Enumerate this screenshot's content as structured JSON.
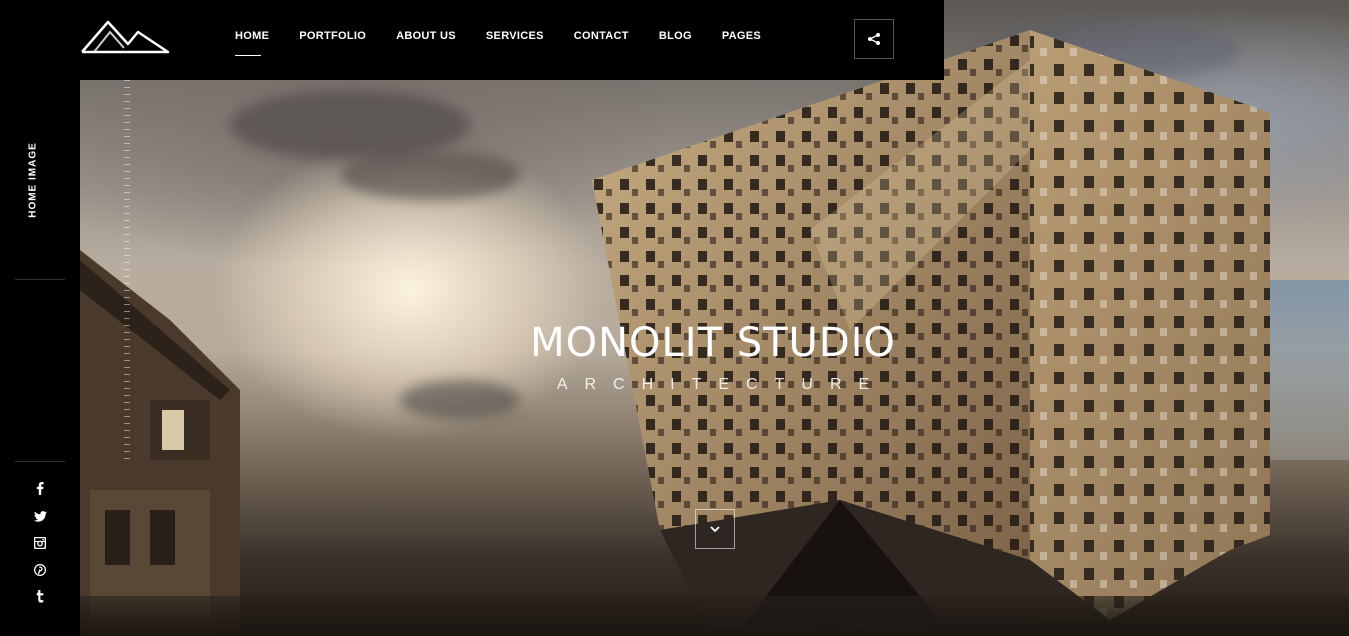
{
  "nav": {
    "items": [
      {
        "label": "HOME",
        "active": true
      },
      {
        "label": "PORTFOLIO",
        "active": false
      },
      {
        "label": "ABOUT US",
        "active": false
      },
      {
        "label": "SERVICES",
        "active": false
      },
      {
        "label": "CONTACT",
        "active": false
      },
      {
        "label": "BLOG",
        "active": false
      },
      {
        "label": "PAGES",
        "active": false
      }
    ],
    "share_icon": "share-icon"
  },
  "sidebar": {
    "section_label": "HOME IMAGE",
    "socials": [
      {
        "icon": "facebook-icon",
        "glyph": "f"
      },
      {
        "icon": "twitter-icon",
        "glyph": "t"
      },
      {
        "icon": "instagram-icon",
        "glyph": "i"
      },
      {
        "icon": "pinterest-icon",
        "glyph": "p"
      },
      {
        "icon": "tumblr-icon",
        "glyph": "t"
      }
    ]
  },
  "hero": {
    "title": "MONOLIT STUDIO",
    "subtitle": "ARCHITECTURE",
    "scroll_icon": "chevron-down-icon"
  },
  "colors": {
    "bar_bg": "#000000",
    "text": "#ffffff",
    "building": "#a48c6a"
  }
}
